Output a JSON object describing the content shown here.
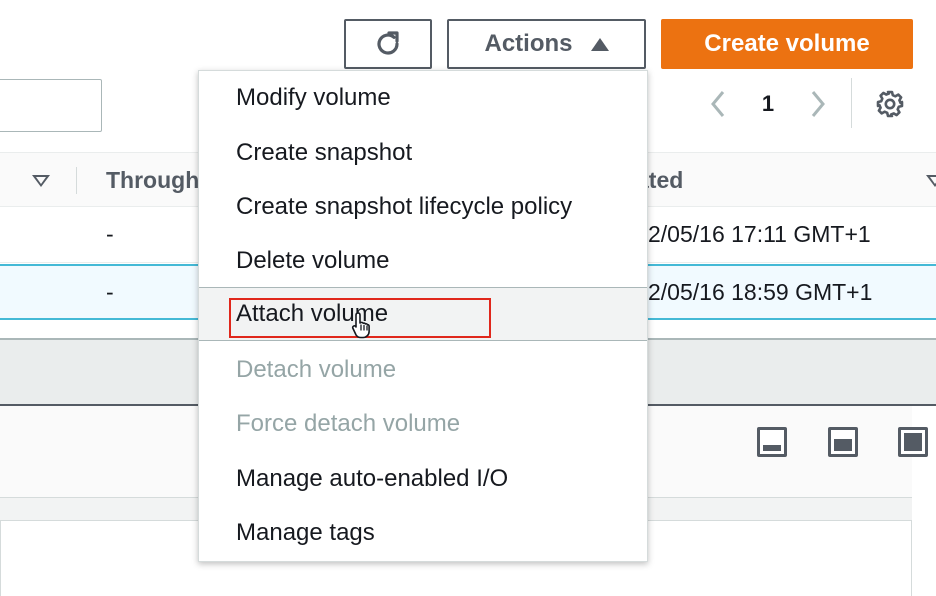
{
  "toolbar": {
    "refresh_icon": "refresh-icon",
    "actions_label": "Actions",
    "actions_icon": "caret-up-icon",
    "create_label": "Create volume",
    "accent_color": "#ec7211"
  },
  "pagination": {
    "current_page": "1",
    "prev_icon": "chevron-left-icon",
    "next_icon": "chevron-right-icon",
    "settings_icon": "gear-icon"
  },
  "table": {
    "columns": [
      "Through",
      "ated"
    ],
    "rows": [
      {
        "throughput": "-",
        "created": "2/05/16 17:11 GMT+1"
      },
      {
        "throughput": "-",
        "created": "2/05/16 18:59 GMT+1"
      }
    ],
    "selected_color": "#44b9d6"
  },
  "menu": {
    "items": [
      {
        "label": "Modify volume",
        "disabled": false
      },
      {
        "label": "Create snapshot",
        "disabled": false
      },
      {
        "label": "Create snapshot lifecycle policy",
        "disabled": false
      },
      {
        "label": "Delete volume",
        "disabled": false
      },
      {
        "label": "Attach volume",
        "disabled": false,
        "hovered": true
      },
      {
        "label": "Detach volume",
        "disabled": true
      },
      {
        "label": "Force detach volume",
        "disabled": true
      },
      {
        "label": "Manage auto-enabled I/O",
        "disabled": false
      },
      {
        "label": "Manage tags",
        "disabled": false
      }
    ],
    "highlight_color": "#e0271b"
  },
  "panel_icons": [
    "panel-bottom-icon",
    "panel-middle-icon",
    "panel-full-icon"
  ]
}
